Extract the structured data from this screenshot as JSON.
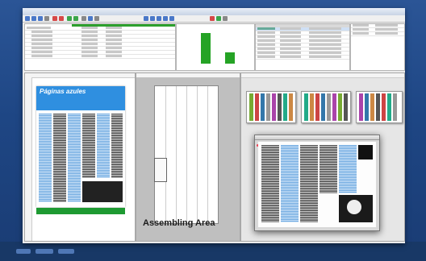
{
  "window": {
    "title": "",
    "controls": [
      "minimize-icon",
      "maximize-icon",
      "close-icon"
    ]
  },
  "toolbar": {
    "icons": [
      "new-icon",
      "open-icon",
      "save-icon",
      "print-icon",
      "undo-icon",
      "redo-icon",
      "zoom-in-icon",
      "zoom-out-icon",
      "grid-icon",
      "chart-icon",
      "settings-icon"
    ]
  },
  "assembly": {
    "label": "Assembling Area"
  },
  "page_preview": {
    "masthead": "Páginas azules"
  },
  "colors": {
    "accent_green": "#1e9a32",
    "accent_blue": "#2f8fe0",
    "desktop": "#2b5596"
  }
}
